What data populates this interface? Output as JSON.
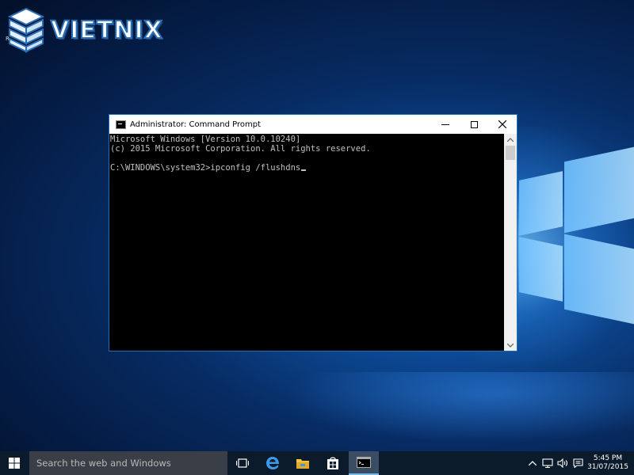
{
  "brand": {
    "logo_text": "VIETNIX",
    "corner_letter": "R"
  },
  "window": {
    "title": "Administrator: Command Prompt",
    "console_lines": [
      "Microsoft Windows [Version 10.0.10240]",
      "(c) 2015 Microsoft Corporation. All rights reserved.",
      "",
      "C:\\WINDOWS\\system32>ipconfig /flushdns"
    ]
  },
  "taskbar": {
    "search_placeholder": "Search the web and Windows",
    "time": "5:45 PM",
    "date": "31/07/2015",
    "icons": [
      "start-icon",
      "task-view-icon",
      "edge-icon",
      "file-explorer-icon",
      "store-icon",
      "command-prompt-icon"
    ],
    "tray_icons": [
      "chevron-up-icon",
      "network-icon",
      "volume-icon",
      "action-center-icon"
    ]
  },
  "colors": {
    "console_bg": "#000000",
    "console_text": "#c0c0c0",
    "taskbar_bg": "#0c1b2c",
    "accent": "#76b9ed"
  }
}
